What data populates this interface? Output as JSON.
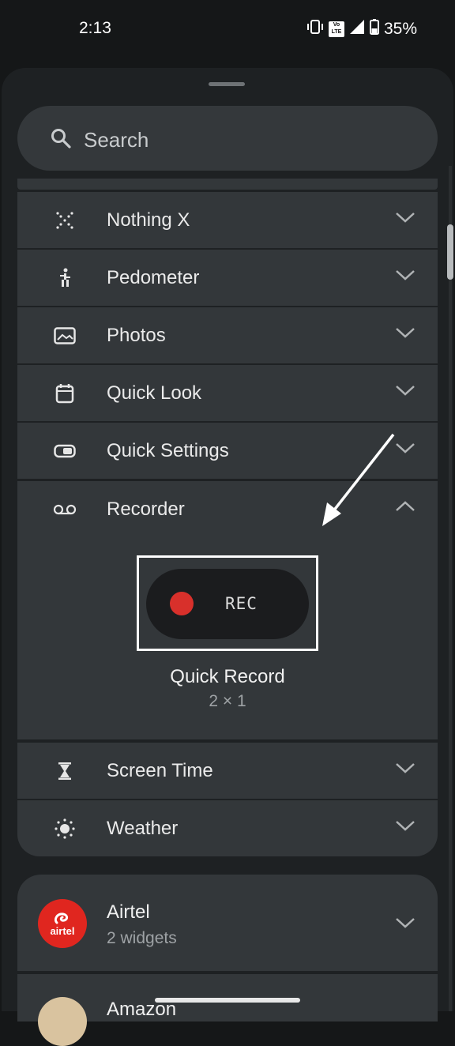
{
  "status_bar": {
    "time": "2:13",
    "battery": "35%",
    "volte": "Vo LTE"
  },
  "search": {
    "placeholder": "Search"
  },
  "widget_list": [
    {
      "label": "Nothing X",
      "icon": "nothing-x-icon"
    },
    {
      "label": "Pedometer",
      "icon": "walking-person-icon"
    },
    {
      "label": "Photos",
      "icon": "photo-icon"
    },
    {
      "label": "Quick Look",
      "icon": "calendar-icon"
    },
    {
      "label": "Quick Settings",
      "icon": "toggle-icon"
    },
    {
      "label": "Recorder",
      "icon": "voicemail-icon"
    },
    {
      "label": "Screen Time",
      "icon": "hourglass-icon"
    },
    {
      "label": "Weather",
      "icon": "sun-icon"
    }
  ],
  "recorder_widget": {
    "rec_label": "REC",
    "name": "Quick Record",
    "size": "2 × 1"
  },
  "apps": [
    {
      "name": "Airtel",
      "subtitle": "2 widgets",
      "logo_text": "airtel"
    },
    {
      "name": "Amazon"
    }
  ],
  "colors": {
    "rec_dot": "#d8302b",
    "airtel": "#e0261f"
  }
}
